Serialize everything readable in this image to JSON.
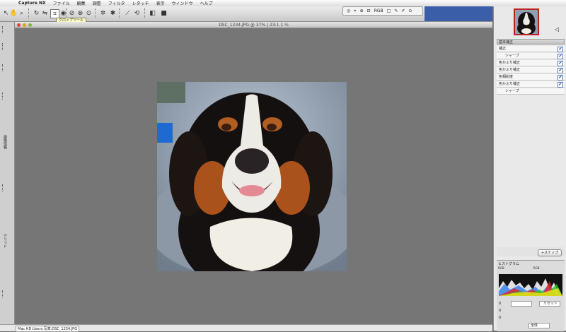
{
  "menubar": {
    "apple_glyph": "",
    "items": [
      {
        "label": "Capture NX",
        "bold": true
      },
      {
        "label": "ファイル"
      },
      {
        "label": "編集"
      },
      {
        "label": "調整"
      },
      {
        "label": "フィルタ"
      },
      {
        "label": "レタッチ"
      },
      {
        "label": "表示"
      },
      {
        "label": "ウィンドウ"
      },
      {
        "label": "ヘルプ"
      }
    ]
  },
  "toolbar": {
    "tooltip": "クロップツール"
  },
  "top_right_bar": {
    "items": [
      "◎",
      "⌖",
      "⊕",
      "⊟",
      "RGB",
      "□",
      "✎",
      "✐",
      "⊙"
    ]
  },
  "document": {
    "title": "DSC_1234.JPG @ 37% | 23:1.1 %"
  },
  "left_tools": {
    "labels": [
      "画像情報",
      "グリッド"
    ]
  },
  "edit_list": {
    "header": "基本補正",
    "steps": [
      {
        "label": "補正",
        "checked": true,
        "indent": false
      },
      {
        "label": "シャープ",
        "checked": true,
        "indent": true
      },
      {
        "label": "色かぶり補正",
        "checked": true,
        "indent": false
      },
      {
        "label": "色かぶり補正",
        "checked": true,
        "indent": false
      },
      {
        "label": "色相彩度",
        "checked": true,
        "indent": false
      },
      {
        "label": "色かぶり補正",
        "checked": true,
        "indent": false
      },
      {
        "label": "シャープ",
        "checked": false,
        "indent": true
      }
    ],
    "checkmark": "✔",
    "add_step_label": "+ステップ"
  },
  "histogram": {
    "title": "ヒストグラム",
    "channel_label": "RGB",
    "dropdown_label": "RGB",
    "row1_label": "0",
    "row2_label": "0",
    "row3_label": "0",
    "reset_label": "リセット",
    "bottom_select": "全体"
  },
  "status_bar": {
    "text": "Mac HD:Users:写真:DSC_1234.JPG"
  },
  "colors": {
    "canvas": "#767676",
    "menubar_blue": "#3a5ea8",
    "selected_border": "#b22222"
  }
}
